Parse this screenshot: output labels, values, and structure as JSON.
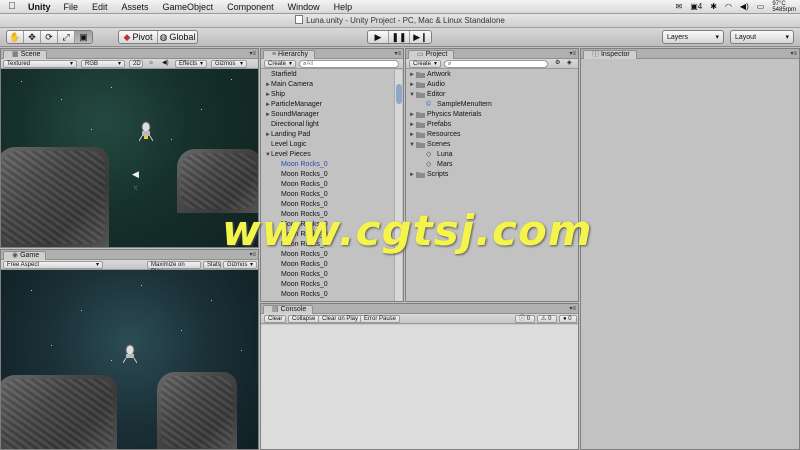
{
  "menubar": {
    "app_name": "Unity",
    "items": [
      "File",
      "Edit",
      "Assets",
      "GameObject",
      "Component",
      "Window",
      "Help"
    ],
    "status_num": "4",
    "temp": "97°C",
    "speed": "5485rpm"
  },
  "window": {
    "title": "Luna.unity - Unity Project - PC, Mac & Linux Standalone"
  },
  "toolbar": {
    "pivot_label": "Pivot",
    "global_label": "Global",
    "layers_label": "Layers",
    "layout_label": "Layout"
  },
  "scene": {
    "tab": "Scene",
    "shading": "Textured",
    "render_mode": "RGB",
    "mode_2d": "2D",
    "effects": "Effects",
    "gizmos": "Gizmos"
  },
  "game": {
    "tab": "Game",
    "aspect": "Free Aspect",
    "maximize": "Maximize on Play",
    "stats": "Stats",
    "gizmos": "Gizmos"
  },
  "hierarchy": {
    "tab": "Hierarchy",
    "create": "Create",
    "search_placeholder": "All",
    "items": [
      {
        "label": "Starfield",
        "indent": 0,
        "arrow": ""
      },
      {
        "label": "Main Camera",
        "indent": 0,
        "arrow": "►"
      },
      {
        "label": "Ship",
        "indent": 0,
        "arrow": "►"
      },
      {
        "label": "ParticleManager",
        "indent": 0,
        "arrow": "►"
      },
      {
        "label": "SoundManager",
        "indent": 0,
        "arrow": "►"
      },
      {
        "label": "Directional light",
        "indent": 0,
        "arrow": ""
      },
      {
        "label": "Landing Pad",
        "indent": 0,
        "arrow": "►"
      },
      {
        "label": "Level Logic",
        "indent": 0,
        "arrow": ""
      },
      {
        "label": "Level Pieces",
        "indent": 0,
        "arrow": "▼"
      },
      {
        "label": "Moon Rocks_0",
        "indent": 1,
        "arrow": "",
        "highlight": true
      },
      {
        "label": "Moon Rocks_0",
        "indent": 1,
        "arrow": ""
      },
      {
        "label": "Moon Rocks_0",
        "indent": 1,
        "arrow": ""
      },
      {
        "label": "Moon Rocks_0",
        "indent": 1,
        "arrow": ""
      },
      {
        "label": "Moon Rocks_0",
        "indent": 1,
        "arrow": ""
      },
      {
        "label": "Moon Rocks_0",
        "indent": 1,
        "arrow": ""
      },
      {
        "label": "Moon Rocks_0",
        "indent": 1,
        "arrow": ""
      },
      {
        "label": "Moon Rocks_0",
        "indent": 1,
        "arrow": ""
      },
      {
        "label": "Moon Rocks_0",
        "indent": 1,
        "arrow": ""
      },
      {
        "label": "Moon Rocks_0",
        "indent": 1,
        "arrow": ""
      },
      {
        "label": "Moon Rocks_0",
        "indent": 1,
        "arrow": ""
      },
      {
        "label": "Moon Rocks_0",
        "indent": 1,
        "arrow": ""
      },
      {
        "label": "Moon Rocks_0",
        "indent": 1,
        "arrow": ""
      },
      {
        "label": "Moon Rocks_0",
        "indent": 1,
        "arrow": ""
      }
    ]
  },
  "project": {
    "tab": "Project",
    "create": "Create",
    "items": [
      {
        "label": "Artwork",
        "indent": 0,
        "arrow": "►",
        "kind": "folder"
      },
      {
        "label": "Audio",
        "indent": 0,
        "arrow": "►",
        "kind": "folder"
      },
      {
        "label": "Editor",
        "indent": 0,
        "arrow": "▼",
        "kind": "folder"
      },
      {
        "label": "SampleMenuItem",
        "indent": 1,
        "arrow": "",
        "kind": "script"
      },
      {
        "label": "Physics Materials",
        "indent": 0,
        "arrow": "►",
        "kind": "folder"
      },
      {
        "label": "Prefabs",
        "indent": 0,
        "arrow": "►",
        "kind": "folder"
      },
      {
        "label": "Resources",
        "indent": 0,
        "arrow": "►",
        "kind": "folder"
      },
      {
        "label": "Scenes",
        "indent": 0,
        "arrow": "▼",
        "kind": "folder"
      },
      {
        "label": "Luna",
        "indent": 1,
        "arrow": "",
        "kind": "unity"
      },
      {
        "label": "Mars",
        "indent": 1,
        "arrow": "",
        "kind": "unity"
      },
      {
        "label": "Scripts",
        "indent": 0,
        "arrow": "►",
        "kind": "folder"
      }
    ]
  },
  "console": {
    "tab": "Console",
    "buttons": [
      "Clear",
      "Collapse",
      "Clear on Play",
      "Error Pause"
    ],
    "counts": {
      "info": "0",
      "warn": "0",
      "error": "0"
    }
  },
  "inspector": {
    "tab": "Inspector"
  },
  "watermark": "www.cgtsj.com"
}
